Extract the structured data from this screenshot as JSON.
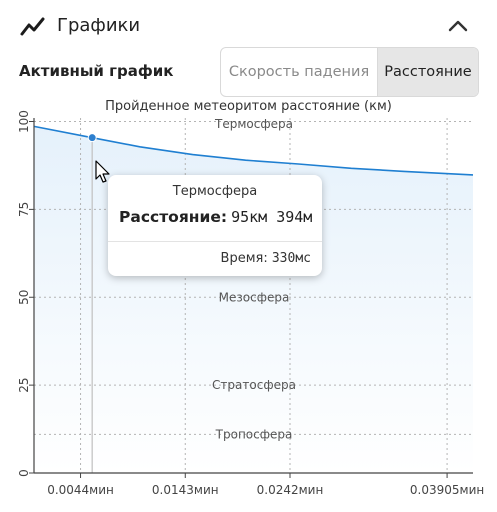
{
  "header": {
    "title": "Графики",
    "icon": "line-chart-icon",
    "collapse_icon": "chevron-up-icon"
  },
  "active_chart": {
    "label": "Активный график",
    "options": [
      "Скорость падения",
      "Расстояние"
    ],
    "selected": "Расстояние"
  },
  "chart_title": "Пройденное метеоритом расстояние (км)",
  "zones": {
    "thermo": "Термосфера",
    "meso": "Мезосфера",
    "strato": "Стратосфера",
    "tropo": "Тропосфера"
  },
  "tooltip": {
    "zone": "Термосфера",
    "label": "Расстояние:",
    "value": "95км 394м",
    "time_label": "Время:",
    "time_value": "330мс"
  },
  "colors": {
    "line": "#1f7fd1",
    "point": "#2d7fce",
    "area_top": "#e5f1fb",
    "area_bottom": "#ffffff"
  },
  "chart_data": {
    "type": "area",
    "title": "Пройденное метеоритом расстояние (км)",
    "x_unit": "мин",
    "x_ticks": [
      "0.0044мин",
      "0.0143мин",
      "0.0242мин",
      "0.03905мин"
    ],
    "x_tick_values": [
      0.0044,
      0.0143,
      0.0242,
      0.03905
    ],
    "xlim": [
      0,
      0.0415
    ],
    "y_ticks": [
      0,
      25,
      50,
      75,
      100
    ],
    "ylim": [
      0,
      101
    ],
    "series": [
      {
        "x": [
          0,
          0.0055,
          0.01,
          0.015,
          0.02,
          0.025,
          0.03,
          0.035,
          0.0415
        ],
        "y": [
          98.6,
          95.4,
          92.8,
          90.6,
          89.0,
          87.9,
          86.7,
          85.8,
          84.8
        ]
      }
    ],
    "highlight": {
      "x": 0.0055,
      "y": 95.4
    },
    "zone_levels": {
      "thermo": 99.3,
      "meso": 50,
      "strato": 25,
      "tropo": 11
    },
    "grid": "dashed"
  }
}
